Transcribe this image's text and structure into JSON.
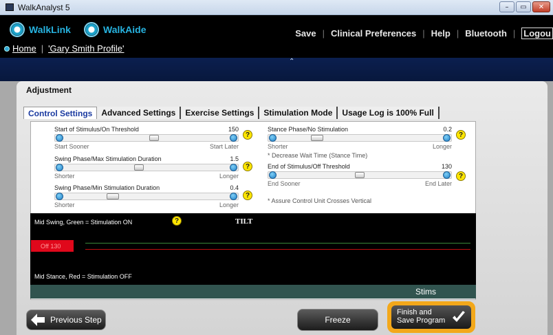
{
  "window": {
    "title": "WalkAnalyst 5",
    "buttons": {
      "minimize": "–",
      "maximize": "▭",
      "close": "✕"
    }
  },
  "header": {
    "brands": [
      "WalkLink",
      "WalkAide"
    ],
    "breadcrumb": {
      "home": "Home",
      "profile": "'Gary Smith Profile'"
    },
    "menu": {
      "save": "Save",
      "clinical": "Clinical Preferences",
      "help": "Help",
      "bluetooth": "Bluetooth",
      "logout": "Logou"
    }
  },
  "panel": {
    "title": "Adjustment",
    "tabs": [
      "Control Settings",
      "Advanced Settings",
      "Exercise Settings",
      "Stimulation Mode",
      "Usage Log is 100% Full"
    ],
    "active_tab": "Control Settings"
  },
  "sliders": {
    "start_stim": {
      "label": "Start of Stimulus/On Threshold",
      "value": "150",
      "min": "Start Sooner",
      "max": "Start Later",
      "level": 0.55
    },
    "swing_max": {
      "label": "Swing Phase/Max Stimulation Duration",
      "value": "1.5",
      "min": "Shorter",
      "max": "Longer",
      "level": 0.45
    },
    "swing_min": {
      "label": "Swing Phase/Min Stimulation Duration",
      "value": "0.4",
      "min": "Shorter",
      "max": "Longer",
      "level": 0.28
    },
    "stance": {
      "label": "Stance Phase/No Stimulation",
      "value": "0.2",
      "min": "Shorter",
      "max": "Longer",
      "level": 0.22
    },
    "end_stim": {
      "label": "End of Stimulus/Off Threshold",
      "value": "130",
      "min": "End Sooner",
      "max": "End Later",
      "level": 0.5
    }
  },
  "notes": {
    "stance_note": "* Decrease Wait Time (Stance Time)",
    "end_note": "* Assure Control Unit Crosses Vertical"
  },
  "graph": {
    "top_label": "Mid Swing, Green = Stimulation ON",
    "bottom_label": "Mid Stance, Red = Stimulation OFF",
    "tilt": "TILT",
    "off_label": "Off 130",
    "stims": "Stims"
  },
  "buttons": {
    "previous": "Previous Step",
    "freeze": "Freeze",
    "finish_line1": "Finish and",
    "finish_line2": "Save Program"
  },
  "help_mark": "?"
}
